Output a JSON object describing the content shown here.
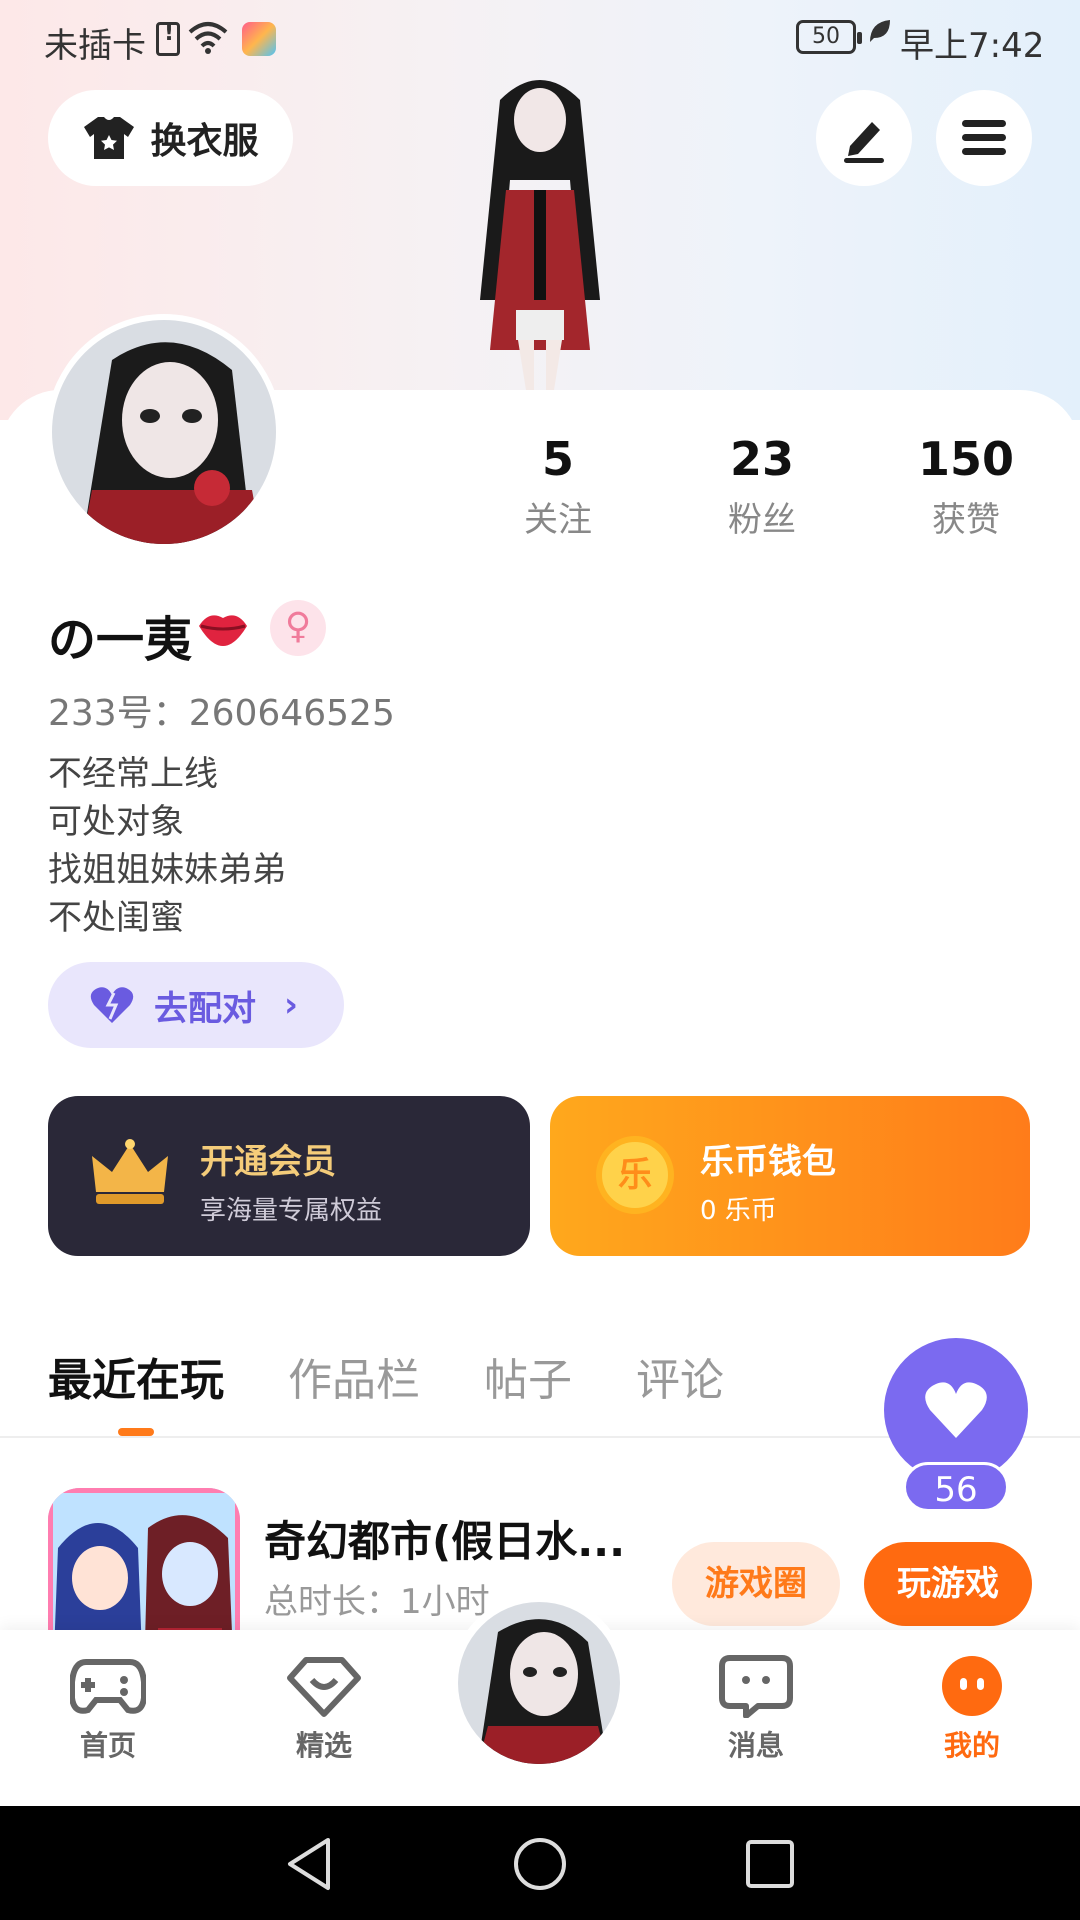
{
  "status_bar": {
    "carrier": "未插卡",
    "battery": "50",
    "time": "早上7:42"
  },
  "header": {
    "outfit_label": "换衣服"
  },
  "stats": [
    {
      "value": "5",
      "label": "关注"
    },
    {
      "value": "23",
      "label": "粉丝"
    },
    {
      "value": "150",
      "label": "获赞"
    }
  ],
  "profile": {
    "nickname": "の一夷",
    "gender_symbol": "♀",
    "uid": "233号：260646525",
    "bio": [
      "不经常上线",
      "可处对象",
      "找姐姐妹妹弟弟",
      "不处闺蜜"
    ],
    "pair_label": "去配对"
  },
  "promo": {
    "vip_title": "开通会员",
    "vip_sub": "享海量专属权益",
    "wallet_title": "乐币钱包",
    "wallet_sub": "0 乐币",
    "coin_char": "乐"
  },
  "tabs": [
    "最近在玩",
    "作品栏",
    "帖子",
    "评论"
  ],
  "like_count": "56",
  "game": {
    "title": "奇幻都市(假日水...",
    "duration": "总时长：1小时",
    "circle_label": "游戏圈",
    "play_label": "玩游戏"
  },
  "bottom_nav": {
    "home": "首页",
    "featured": "精选",
    "messages": "消息",
    "mine": "我的"
  },
  "colors": {
    "accent": "#ff6a10",
    "purple": "#7b6af0",
    "vip_bg": "#2a2838"
  }
}
